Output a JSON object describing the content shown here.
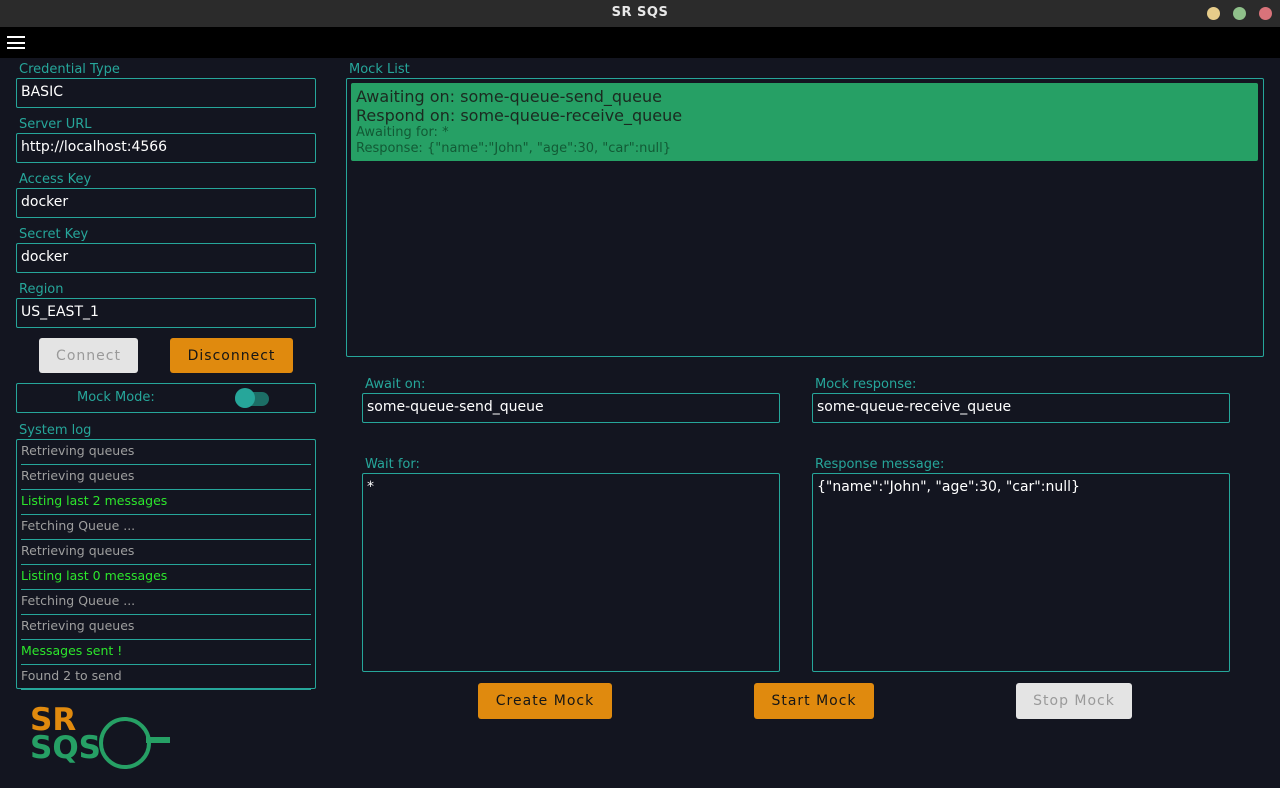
{
  "window": {
    "title": "SR SQS"
  },
  "colors": {
    "accent": "#26a69a",
    "button_orange": "#e08a0e",
    "mock_card": "#26a065",
    "log_success": "#2ce62c",
    "background": "#131520"
  },
  "sidebar": {
    "credential_type": {
      "label": "Credential Type",
      "value": "BASIC"
    },
    "server_url": {
      "label": "Server URL",
      "value": "http://localhost:4566"
    },
    "access_key": {
      "label": "Access Key",
      "value": "docker"
    },
    "secret_key": {
      "label": "Secret Key",
      "value": "docker"
    },
    "region": {
      "label": "Region",
      "value": "US_EAST_1"
    },
    "connect_label": "Connect",
    "disconnect_label": "Disconnect",
    "mock_mode": {
      "label": "Mock Mode:",
      "enabled": true
    },
    "system_log": {
      "label": "System log",
      "items": [
        {
          "text": "Retrieving queues",
          "status": "info"
        },
        {
          "text": "Retrieving queues",
          "status": "info"
        },
        {
          "text": "Listing last 2 messages",
          "status": "success"
        },
        {
          "text": "Fetching Queue ...",
          "status": "info"
        },
        {
          "text": "Retrieving queues",
          "status": "info"
        },
        {
          "text": "Listing last 0 messages",
          "status": "success"
        },
        {
          "text": "Fetching Queue ...",
          "status": "info"
        },
        {
          "text": "Retrieving queues",
          "status": "info"
        },
        {
          "text": "Messages sent !",
          "status": "success"
        },
        {
          "text": "Found 2 to send",
          "status": "info"
        }
      ]
    },
    "logo": {
      "line1": "SR",
      "line2": "SQS"
    }
  },
  "main": {
    "mock_list": {
      "label": "Mock List",
      "items": [
        {
          "awaiting_on": "Awaiting on: some-queue-send_queue",
          "respond_on": "Respond on: some-queue-receive_queue",
          "awaiting_for": "Awaiting for: *",
          "response": "Response: {\"name\":\"John\", \"age\":30, \"car\":null}"
        }
      ]
    },
    "await_on": {
      "label": "Await on:",
      "value": "some-queue-send_queue"
    },
    "mock_response": {
      "label": "Mock response:",
      "value": "some-queue-receive_queue"
    },
    "wait_for": {
      "label": "Wait for:",
      "value": "*"
    },
    "response_message": {
      "label": "Response message:",
      "value": "{\"name\":\"John\", \"age\":30, \"car\":null}"
    },
    "create_mock_label": "Create Mock",
    "start_mock_label": "Start Mock",
    "stop_mock_label": "Stop Mock"
  }
}
